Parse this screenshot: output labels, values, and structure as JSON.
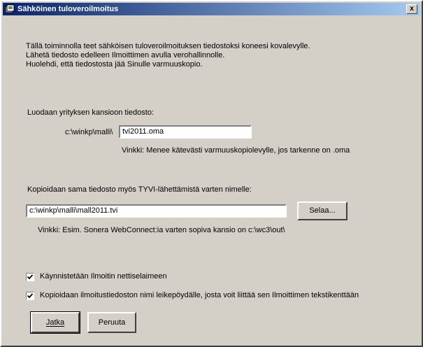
{
  "window": {
    "title": "Sähköinen tuloveroilmoitus",
    "close_label": "x"
  },
  "intro": {
    "line1": "Tällä toiminnolla teet sähköisen tuloveroilmoituksen tiedostoksi koneesi kovalevylle.",
    "line2": "Lähetä tiedosto edelleen Ilmoittimen avulla verohallinnolle.",
    "line3": "Huolehdi, että tiedostosta jää Sinulle varmuuskopio."
  },
  "folder_section": {
    "label": "Luodaan yrityksen kansioon tiedosto:",
    "path_prefix": "c:\\winkp\\malli\\",
    "filename_value": "tvi2011.oma",
    "hint": "Vinkki: Menee kätevästi varmuuskopiolevylle, jos tarkenne on .oma"
  },
  "tyvi_section": {
    "label": "Kopioidaan sama tiedosto myös TYVI-lähettämistä varten nimelle:",
    "path_value": "c:\\winkp\\malli\\mall2011.tvi",
    "browse_button": "Selaa...",
    "hint": "Vinkki: Esim. Sonera WebConnect:ia varten sopiva kansio on c:\\wc3\\out\\"
  },
  "options": {
    "start_browser": {
      "label": "Käynnistetään Ilmoitin nettiselaimeen",
      "checked": true
    },
    "copy_clipboard": {
      "label": "Kopioidaan ilmoitustiedoston nimi leikepöydälle, josta voit liittää sen Ilmoittimen tekstikenttään",
      "checked": true
    }
  },
  "buttons": {
    "continue": "Jatka",
    "cancel": "Peruuta"
  }
}
